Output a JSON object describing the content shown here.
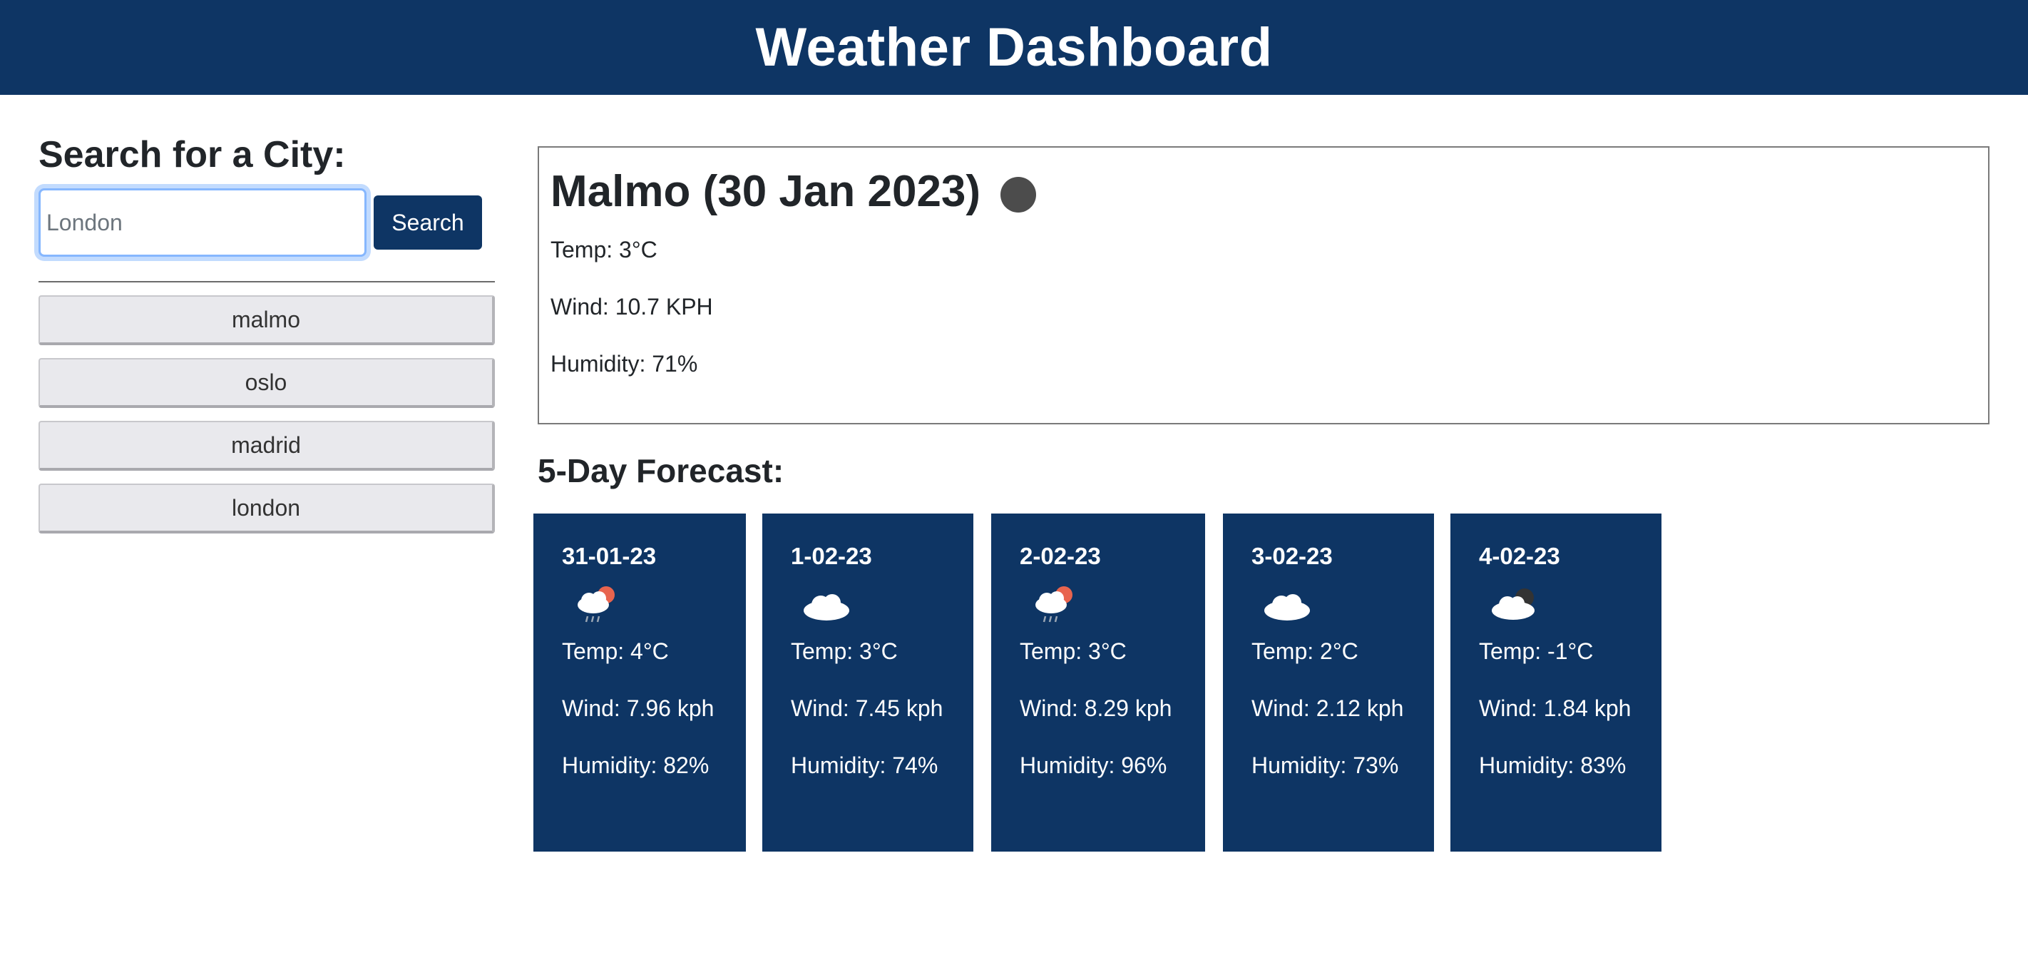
{
  "header": {
    "title": "Weather Dashboard"
  },
  "sidebar": {
    "heading": "Search for a City:",
    "search": {
      "value": "",
      "placeholder": "London"
    },
    "search_button_label": "Search",
    "history": [
      "malmo",
      "oslo",
      "madrid",
      "london"
    ]
  },
  "current": {
    "title": "Malmo (30 Jan 2023)",
    "icon": "night-clear-icon",
    "temp": "Temp: 3°C",
    "wind": "Wind: 10.7 KPH",
    "humidity": "Humidity: 71%"
  },
  "forecast": {
    "heading": "5-Day Forecast:",
    "days": [
      {
        "date": "31-01-23",
        "icon": "rain-sun-icon",
        "temp": "Temp: 4°C",
        "wind": "Wind: 7.96 kph",
        "humidity": "Humidity: 82%"
      },
      {
        "date": "1-02-23",
        "icon": "cloud-icon",
        "temp": "Temp: 3°C",
        "wind": "Wind: 7.45 kph",
        "humidity": "Humidity: 74%"
      },
      {
        "date": "2-02-23",
        "icon": "rain-sun-icon",
        "temp": "Temp: 3°C",
        "wind": "Wind: 8.29 kph",
        "humidity": "Humidity: 96%"
      },
      {
        "date": "3-02-23",
        "icon": "cloud-icon",
        "temp": "Temp: 2°C",
        "wind": "Wind: 2.12 kph",
        "humidity": "Humidity: 73%"
      },
      {
        "date": "4-02-23",
        "icon": "cloud-moon-icon",
        "temp": "Temp: -1°C",
        "wind": "Wind: 1.84 kph",
        "humidity": "Humidity: 83%"
      }
    ]
  },
  "colors": {
    "primary": "#0e3564",
    "history_button_bg": "#e9e9ed"
  }
}
